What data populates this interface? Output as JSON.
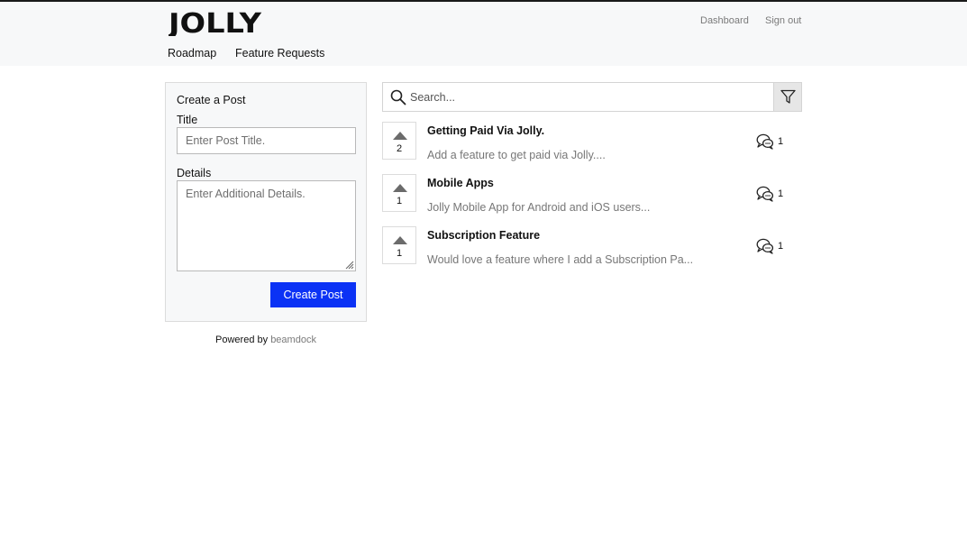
{
  "header": {
    "logo_text": "JOLLY",
    "links": {
      "dashboard": "Dashboard",
      "sign_out": "Sign out"
    },
    "tabs": [
      {
        "label": "Roadmap"
      },
      {
        "label": "Feature Requests"
      }
    ]
  },
  "create_post": {
    "heading": "Create a Post",
    "title_label": "Title",
    "title_placeholder": "Enter Post Title.",
    "details_label": "Details",
    "details_placeholder": "Enter Additional Details.",
    "submit_label": "Create Post"
  },
  "footer": {
    "powered_prefix": "Powered by",
    "powered_brand": "beamdock"
  },
  "search": {
    "placeholder": "Search..."
  },
  "posts": [
    {
      "votes": "2",
      "title": "Getting Paid Via Jolly.",
      "description": "Add a feature to get paid via Jolly....",
      "comments": "1"
    },
    {
      "votes": "1",
      "title": "Mobile Apps",
      "description": "Jolly Mobile App for Android and iOS users...",
      "comments": "1"
    },
    {
      "votes": "1",
      "title": "Subscription Feature",
      "description": "Would love a feature where I add a Subscription Pa...",
      "comments": "1"
    }
  ],
  "colors": {
    "primary_button": "#0b32f5",
    "header_background": "#f7f8f9",
    "muted_text": "#777777"
  },
  "icons": [
    "search-icon",
    "filter-icon",
    "upvote-arrow-icon",
    "comment-bubbles-icon"
  ]
}
